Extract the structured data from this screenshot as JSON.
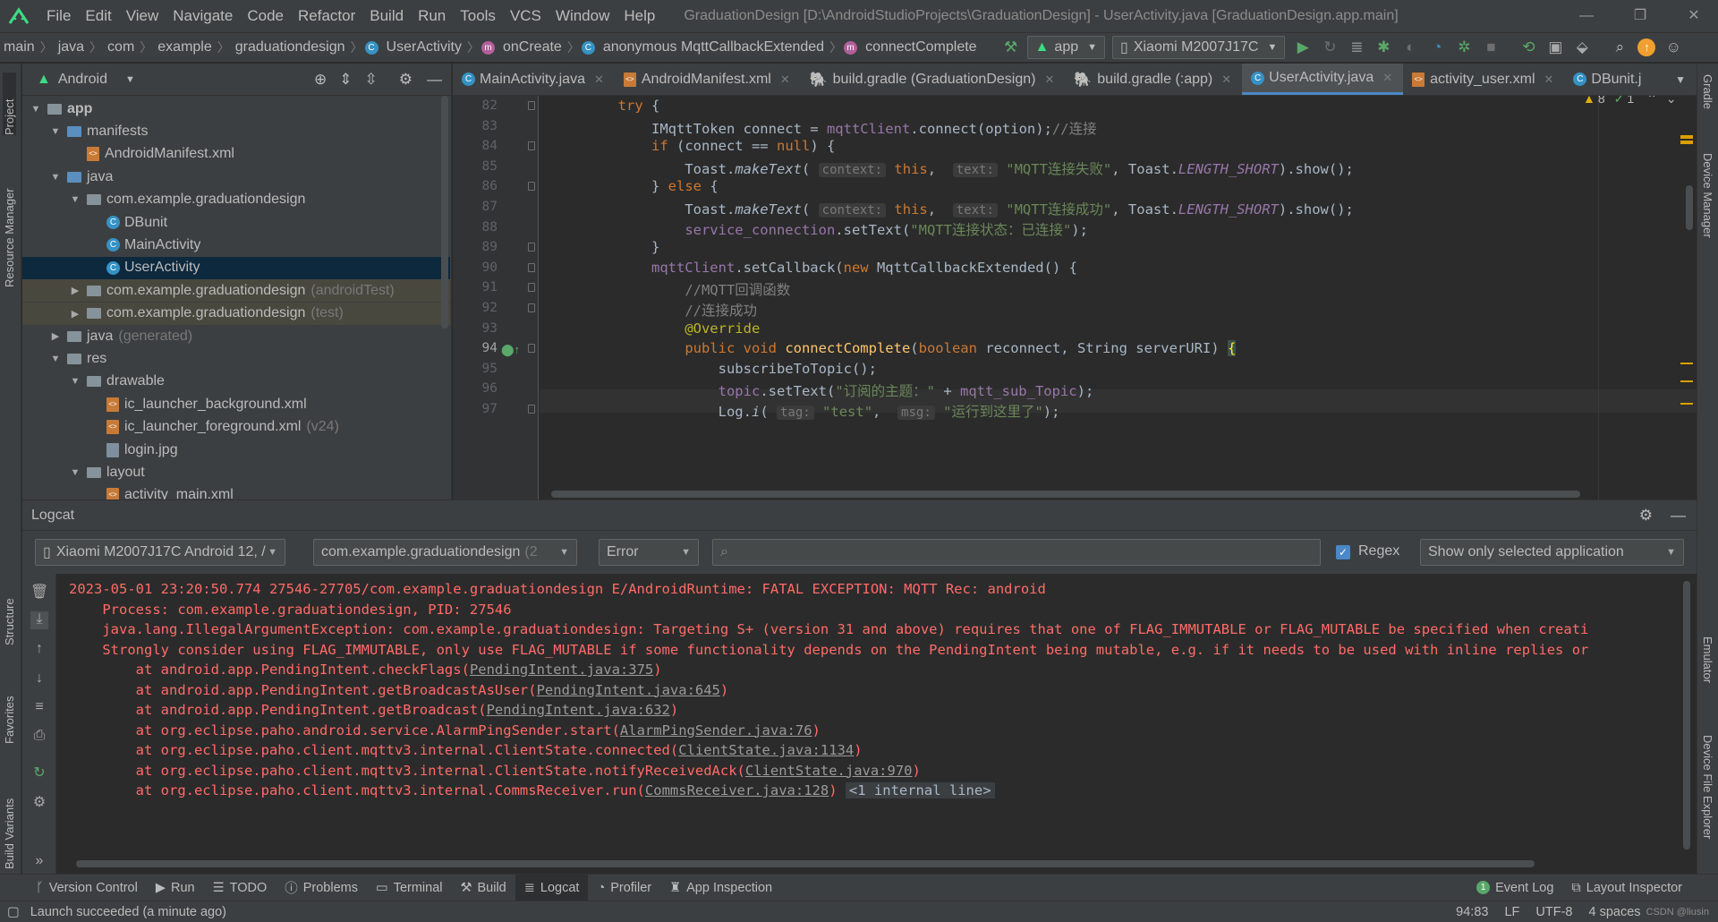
{
  "window": {
    "title": "GraduationDesign [D:\\AndroidStudioProjects\\GraduationDesign] - UserActivity.java [GraduationDesign.app.main]",
    "menus": [
      "File",
      "Edit",
      "View",
      "Navigate",
      "Code",
      "Refactor",
      "Build",
      "Run",
      "Tools",
      "VCS",
      "Window",
      "Help"
    ]
  },
  "breadcrumb": [
    "main",
    "java",
    "com",
    "example",
    "graduationdesign",
    "UserActivity",
    "onCreate",
    "anonymous MqttCallbackExtended",
    "connectComplete"
  ],
  "toolbar": {
    "run_config": "app",
    "device": "Xiaomi M2007J17C"
  },
  "project": {
    "view": "Android",
    "tree": [
      {
        "label": "app",
        "indent": 0,
        "arrow": "▼",
        "icon": "folder"
      },
      {
        "label": "manifests",
        "indent": 1,
        "arrow": "▼",
        "icon": "folder-blue"
      },
      {
        "label": "AndroidManifest.xml",
        "indent": 2,
        "arrow": "",
        "icon": "xml"
      },
      {
        "label": "java",
        "indent": 1,
        "arrow": "▼",
        "icon": "folder-blue"
      },
      {
        "label": "com.example.graduationdesign",
        "indent": 2,
        "arrow": "▼",
        "icon": "folder"
      },
      {
        "label": "DBunit",
        "indent": 3,
        "arrow": "",
        "icon": "class"
      },
      {
        "label": "MainActivity",
        "indent": 3,
        "arrow": "",
        "icon": "class"
      },
      {
        "label": "UserActivity",
        "indent": 3,
        "arrow": "",
        "icon": "class",
        "selected": true
      },
      {
        "label": "com.example.graduationdesign",
        "suffix": "(androidTest)",
        "indent": 2,
        "arrow": "▶",
        "icon": "folder",
        "test": true
      },
      {
        "label": "com.example.graduationdesign",
        "suffix": "(test)",
        "indent": 2,
        "arrow": "▶",
        "icon": "folder",
        "test": true
      },
      {
        "label": "java",
        "suffix": "(generated)",
        "indent": 1,
        "arrow": "▶",
        "icon": "folder"
      },
      {
        "label": "res",
        "indent": 1,
        "arrow": "▼",
        "icon": "folder"
      },
      {
        "label": "drawable",
        "indent": 2,
        "arrow": "▼",
        "icon": "folder"
      },
      {
        "label": "ic_launcher_background.xml",
        "indent": 3,
        "arrow": "",
        "icon": "xml"
      },
      {
        "label": "ic_launcher_foreground.xml",
        "suffix": "(v24)",
        "indent": 3,
        "arrow": "",
        "icon": "xml"
      },
      {
        "label": "login.jpg",
        "indent": 3,
        "arrow": "",
        "icon": "img"
      },
      {
        "label": "layout",
        "indent": 2,
        "arrow": "▼",
        "icon": "folder"
      },
      {
        "label": "activity_main.xml",
        "indent": 3,
        "arrow": "",
        "icon": "xml"
      }
    ]
  },
  "tabs": [
    {
      "label": "MainActivity.java",
      "icon": "C"
    },
    {
      "label": "AndroidManifest.xml",
      "icon": "M"
    },
    {
      "label": "build.gradle (GraduationDesign)",
      "icon": "G"
    },
    {
      "label": "build.gradle (:app)",
      "icon": "G"
    },
    {
      "label": "UserActivity.java",
      "icon": "C",
      "active": true
    },
    {
      "label": "activity_user.xml",
      "icon": "X"
    },
    {
      "label": "DBunit.j",
      "icon": "C"
    }
  ],
  "editor": {
    "warnings": "8",
    "ok": "1",
    "line_numbers": [
      "82",
      "83",
      "84",
      "85",
      "86",
      "87",
      "88",
      "89",
      "90",
      "91",
      "92",
      "93",
      "94",
      "95",
      "96",
      "97"
    ]
  },
  "logcat": {
    "title": "Logcat",
    "device": "Xiaomi M2007J17C Android 12, /",
    "package": "com.example.graduationdesign",
    "package_suffix": "(2",
    "level": "Error",
    "regex_label": "Regex",
    "filter": "Show only selected application",
    "lines": [
      "2023-05-01 23:20:50.774 27546-27705/com.example.graduationdesign E/AndroidRuntime: FATAL EXCEPTION: MQTT Rec: android",
      "    Process: com.example.graduationdesign, PID: 27546",
      "    java.lang.IllegalArgumentException: com.example.graduationdesign: Targeting S+ (version 31 and above) requires that one of FLAG_IMMUTABLE or FLAG_MUTABLE be specified when creati",
      "    Strongly consider using FLAG_IMMUTABLE, only use FLAG_MUTABLE if some functionality depends on the PendingIntent being mutable, e.g. if it needs to be used with inline replies or"
    ],
    "stack": [
      {
        "prefix": "        at android.app.PendingIntent.checkFlags(",
        "link": "PendingIntent.java:375",
        "suffix": ")"
      },
      {
        "prefix": "        at android.app.PendingIntent.getBroadcastAsUser(",
        "link": "PendingIntent.java:645",
        "suffix": ")"
      },
      {
        "prefix": "        at android.app.PendingIntent.getBroadcast(",
        "link": "PendingIntent.java:632",
        "suffix": ")"
      },
      {
        "prefix": "        at org.eclipse.paho.android.service.AlarmPingSender.start(",
        "link": "AlarmPingSender.java:76",
        "suffix": ")"
      },
      {
        "prefix": "        at org.eclipse.paho.client.mqttv3.internal.ClientState.connected(",
        "link": "ClientState.java:1134",
        "suffix": ")"
      },
      {
        "prefix": "        at org.eclipse.paho.client.mqttv3.internal.ClientState.notifyReceivedAck(",
        "link": "ClientState.java:970",
        "suffix": ")"
      },
      {
        "prefix": "        at org.eclipse.paho.client.mqttv3.internal.CommsReceiver.run(",
        "link": "CommsReceiver.java:128",
        "suffix": ")",
        "extra": "<1 internal line>"
      }
    ]
  },
  "bottom_tools": [
    "Version Control",
    "Run",
    "TODO",
    "Problems",
    "Terminal",
    "Build",
    "Logcat",
    "Profiler",
    "App Inspection"
  ],
  "bottom_right_tools": [
    "Event Log",
    "Layout Inspector"
  ],
  "status": {
    "message": "Launch succeeded (a minute ago)",
    "position": "94:83",
    "line_sep": "LF",
    "encoding": "UTF-8",
    "indent": "4 spaces"
  },
  "side_left": [
    "Project",
    "Resource Manager",
    "Structure",
    "Favorites",
    "Build Variants"
  ],
  "side_right": [
    "Gradle",
    "Device Manager",
    "Emulator",
    "Device File Explorer"
  ],
  "watermark": "CSDN @liusin"
}
